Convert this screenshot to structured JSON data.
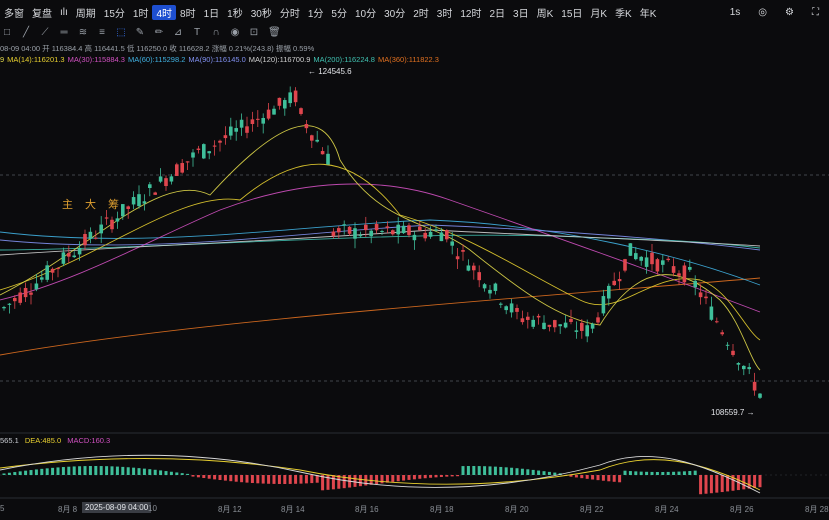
{
  "toolbar": {
    "items": [
      "多窗",
      "复盘",
      "",
      "周期",
      "15分",
      "1时",
      "4时",
      "8时",
      "1日",
      "1秒",
      "30秒",
      "分时",
      "1分",
      "5分",
      "10分",
      "30分",
      "2时",
      "3时",
      "12时",
      "2日",
      "3日",
      "周K",
      "15日",
      "月K",
      "季K",
      "年K"
    ],
    "active_index": 6,
    "right_label": "1s"
  },
  "ohlc_info": "08-09 04:00  开 116384.4  高 116441.5  低 116250.0  收 116628.2  涨幅 0.21%(243.8)  振幅 0.59%",
  "ma_lines": [
    {
      "label": "9",
      "color": "#e0d84a"
    },
    {
      "label": "MA(14):116201.3",
      "color": "#e8d030"
    },
    {
      "label": "MA(30):115884.3",
      "color": "#d050c0"
    },
    {
      "label": "MA(60):115298.2",
      "color": "#40b0e0"
    },
    {
      "label": "MA(90):116145.0",
      "color": "#8090f0"
    },
    {
      "label": "MA(120):116700.9",
      "color": "#d0d0d0"
    },
    {
      "label": "MA(200):116224.8",
      "color": "#40c0b0"
    },
    {
      "label": "MA(360):111822.3",
      "color": "#e07020"
    }
  ],
  "annotations": {
    "high": "124545.6",
    "low": "108559.7"
  },
  "side_labels": [
    "主",
    "大",
    "筹"
  ],
  "macd": {
    "dif": "565.1",
    "dea": "DEA:485.0",
    "macd": "MACD:160.3"
  },
  "xaxis": {
    "labels": [
      "5",
      "8月 8",
      "10",
      "8月 12",
      "8月 14",
      "8月 16",
      "8月 18",
      "8月 20",
      "8月 22",
      "8月 24",
      "8月 26",
      "8月 28"
    ],
    "crosshair_label": "2025-08-09 04:00"
  },
  "colors": {
    "up": "#3fbf9a",
    "down": "#e0464e",
    "accent": "#1e4fd0"
  },
  "chart_data": {
    "type": "candlestick",
    "high": 124545.6,
    "low": 108559.7,
    "ohlc": [
      [
        116384.4,
        116441.5,
        116250.0,
        116628.2
      ],
      [
        116628,
        117100,
        116300,
        116900
      ],
      [
        116900,
        117400,
        116700,
        117200
      ],
      [
        117200,
        118200,
        117000,
        118000
      ],
      [
        118000,
        119500,
        117800,
        119200
      ],
      [
        119200,
        119800,
        118500,
        119000
      ],
      [
        119000,
        119600,
        118200,
        118700
      ],
      [
        118700,
        121500,
        118500,
        121200
      ],
      [
        121200,
        122300,
        120800,
        121900
      ],
      [
        121900,
        122400,
        120500,
        120800
      ],
      [
        120800,
        121600,
        120300,
        121300
      ],
      [
        121300,
        123100,
        121000,
        122800
      ],
      [
        122800,
        124545.6,
        122400,
        124200
      ],
      [
        124200,
        124400,
        121500,
        121800
      ],
      [
        121800,
        122100,
        119800,
        120100
      ],
      [
        120100,
        120600,
        119000,
        119400
      ],
      [
        119400,
        119900,
        118600,
        119100
      ],
      [
        119100,
        119500,
        118700,
        119300
      ],
      [
        119300,
        119700,
        118900,
        119100
      ],
      [
        119100,
        119400,
        117000,
        117300
      ],
      [
        117300,
        117800,
        115200,
        115600
      ],
      [
        115600,
        116100,
        114300,
        114800
      ],
      [
        114800,
        115300,
        112800,
        113300
      ],
      [
        113300,
        114100,
        112600,
        113700
      ],
      [
        113700,
        114500,
        113200,
        113500
      ],
      [
        113500,
        113900,
        112200,
        112600
      ],
      [
        112600,
        113300,
        111900,
        112400
      ],
      [
        112400,
        113100,
        112000,
        112900
      ],
      [
        112900,
        117200,
        112700,
        116800
      ],
      [
        116800,
        117100,
        115200,
        115600
      ],
      [
        115600,
        115900,
        114700,
        115000
      ],
      [
        115000,
        115400,
        113300,
        113600
      ],
      [
        113600,
        113800,
        110900,
        111200
      ],
      [
        111200,
        111700,
        109800,
        110200
      ],
      [
        110200,
        110600,
        108559.7,
        109800
      ],
      [
        109800,
        110300,
        109200,
        110100
      ]
    ]
  }
}
